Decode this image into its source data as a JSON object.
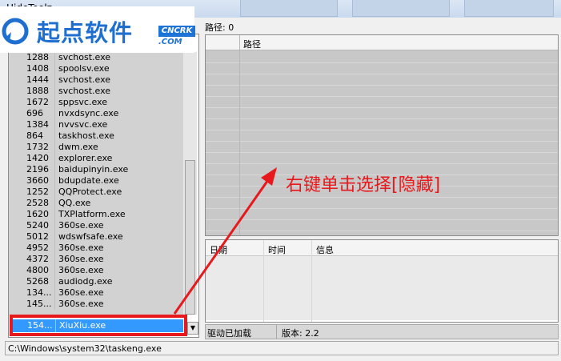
{
  "window": {
    "title": "HideToolz"
  },
  "watermark": {
    "text": "起点软件",
    "badge_top": "CNCRK",
    "badge_bottom": ".COM"
  },
  "processes": [
    {
      "pid": "1288",
      "name": "svchost.exe"
    },
    {
      "pid": "1408",
      "name": "spoolsv.exe"
    },
    {
      "pid": "1444",
      "name": "svchost.exe"
    },
    {
      "pid": "1888",
      "name": "svchost.exe"
    },
    {
      "pid": "1672",
      "name": "sppsvc.exe"
    },
    {
      "pid": "696",
      "name": "nvxdsync.exe"
    },
    {
      "pid": "1384",
      "name": "nvvsvc.exe"
    },
    {
      "pid": "864",
      "name": "taskhost.exe"
    },
    {
      "pid": "1732",
      "name": "dwm.exe"
    },
    {
      "pid": "1420",
      "name": "explorer.exe"
    },
    {
      "pid": "2196",
      "name": "baidupinyin.exe"
    },
    {
      "pid": "3660",
      "name": "bdupdate.exe"
    },
    {
      "pid": "1252",
      "name": "QQProtect.exe"
    },
    {
      "pid": "2528",
      "name": "QQ.exe"
    },
    {
      "pid": "1620",
      "name": "TXPlatform.exe"
    },
    {
      "pid": "5240",
      "name": "360se.exe"
    },
    {
      "pid": "5012",
      "name": "wdswfsafe.exe"
    },
    {
      "pid": "4952",
      "name": "360se.exe"
    },
    {
      "pid": "4372",
      "name": "360se.exe"
    },
    {
      "pid": "4800",
      "name": "360se.exe"
    },
    {
      "pid": "5268",
      "name": "audiodg.exe"
    },
    {
      "pid": "134...",
      "name": "360se.exe"
    },
    {
      "pid": "145...",
      "name": "360se.exe"
    }
  ],
  "selected_process": {
    "pid": "154...",
    "name": "XiuXiu.exe"
  },
  "path_panel": {
    "label": "路径: 0",
    "column": "路径"
  },
  "log_panel": {
    "col_date": "日期",
    "col_time": "时间",
    "col_info": "信息"
  },
  "status": {
    "driver": "驱动已加载",
    "version": "版本: 2.2"
  },
  "bottom_path": "C:\\Windows\\system32\\taskeng.exe",
  "annotation": {
    "text": "右键单击选择[隐藏]",
    "color": "#e8191d"
  },
  "colors": {
    "selection": "#3399ff",
    "brand_blue": "#1f6fd1"
  }
}
